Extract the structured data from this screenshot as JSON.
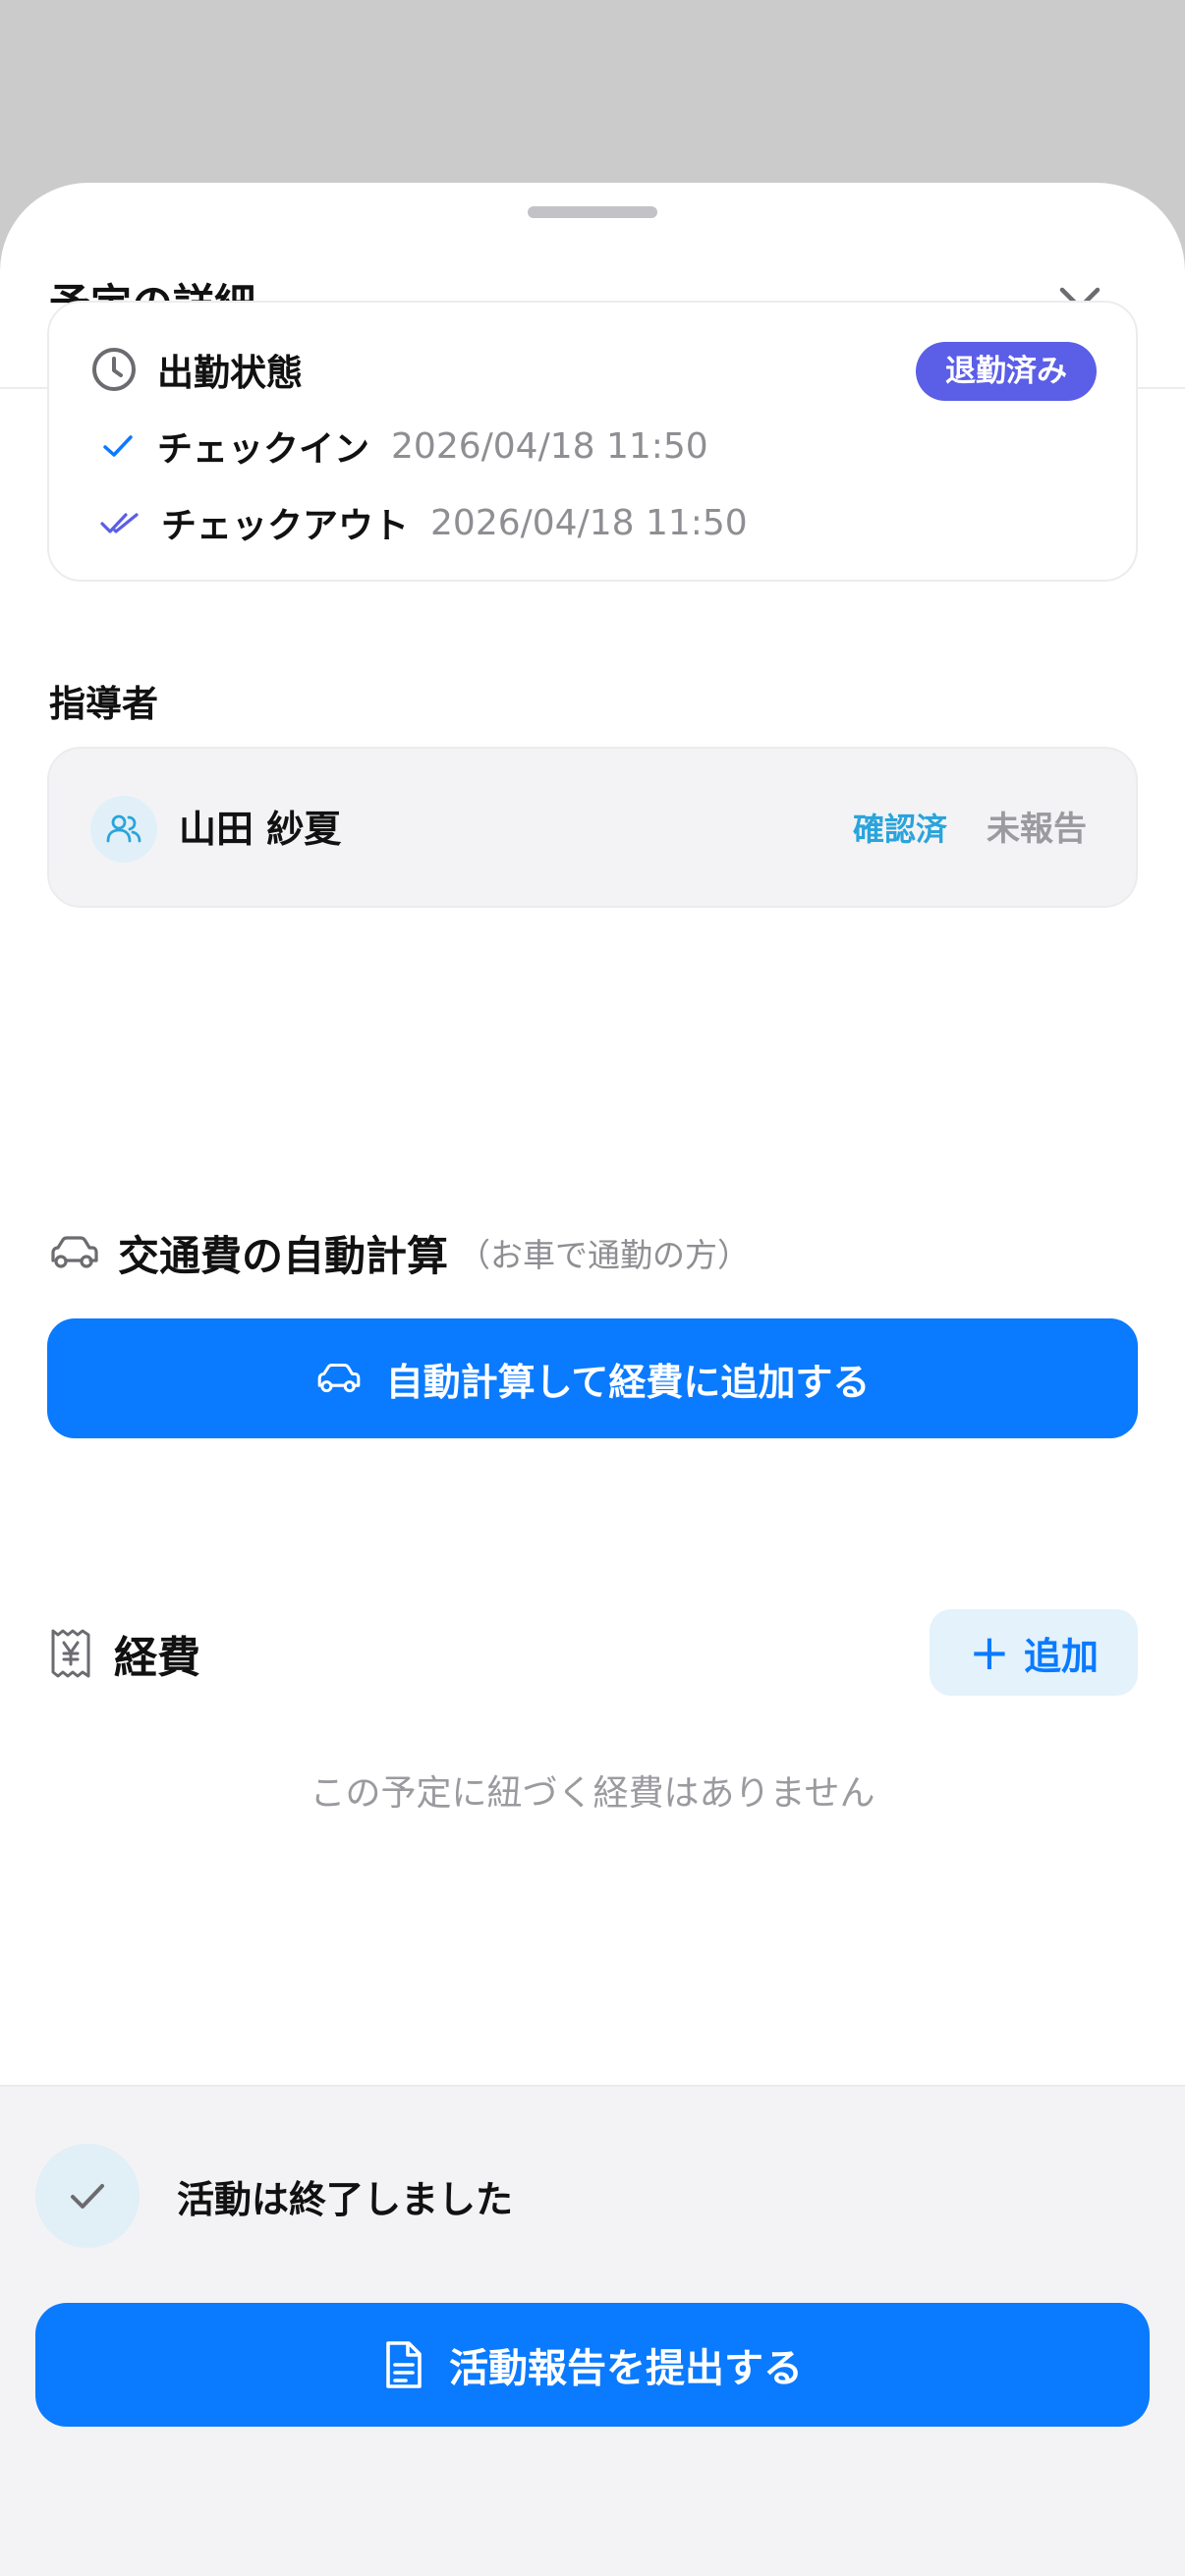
{
  "sheet": {
    "title": "予定の詳細",
    "close_icon": "close-icon"
  },
  "attendance": {
    "title": "出勤状態",
    "badge": "退勤済み",
    "checkin_label": "チェックイン",
    "checkin_time": "2026/04/18 11:50",
    "checkout_label": "チェックアウト",
    "checkout_time": "2026/04/18 11:50"
  },
  "instructor": {
    "section_label": "指導者",
    "name": "山田 紗夏",
    "confirmed": "確認済",
    "report_status": "未報告"
  },
  "commute": {
    "title": "交通費の自動計算",
    "subtitle": "（お車で通勤の方）",
    "button_label": "自動計算して経費に追加する"
  },
  "expenses": {
    "title": "経費",
    "add_label": "追加",
    "empty_message": "この予定に紐づく経費はありません"
  },
  "footer": {
    "status_text": "活動は終了しました",
    "submit_label": "活動報告を提出する"
  },
  "colors": {
    "accent": "#0a7aff",
    "badge": "#5b5ee6",
    "confirmed": "#2aa4db",
    "muted": "#8e8e93"
  }
}
